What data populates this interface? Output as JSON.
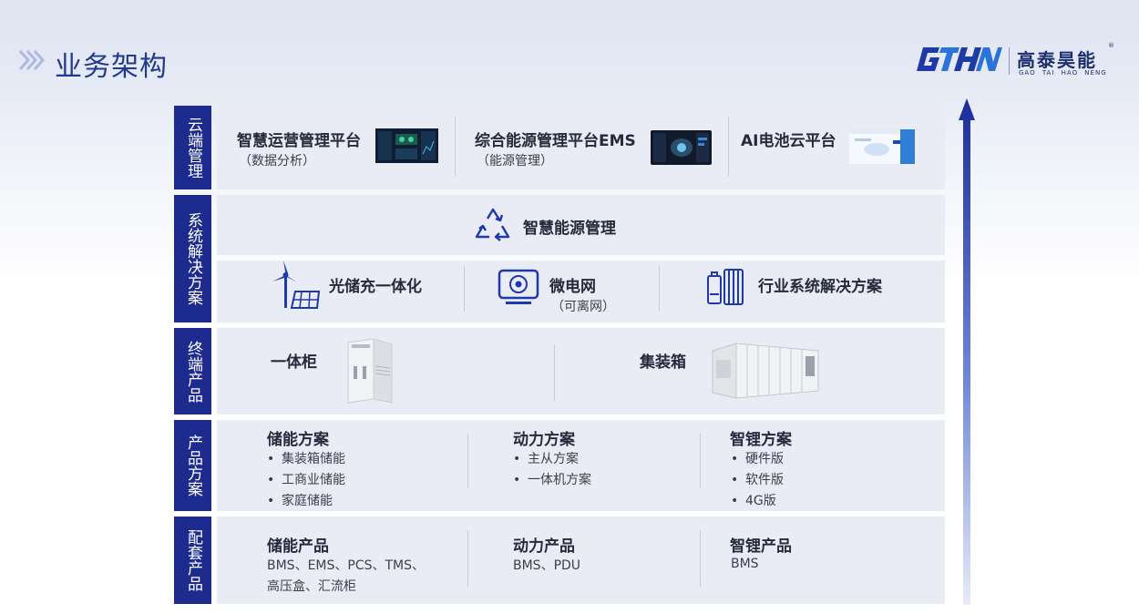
{
  "header": {
    "title": "业务架构",
    "logo": {
      "letters": "GTHN",
      "name_cn": "高泰昊能",
      "name_en": "GAO TAI HAO NENG",
      "reg": "®"
    }
  },
  "rows": {
    "cloud": {
      "label": "云端管理",
      "items": [
        {
          "title": "智慧运营管理平台",
          "sub": "（数据分析）"
        },
        {
          "title": "综合能源管理平台EMS",
          "sub": "（能源管理）"
        },
        {
          "title": "AI电池云平台"
        }
      ]
    },
    "system": {
      "label": "系统解决方案",
      "top": "智慧能源管理",
      "items": [
        {
          "title": "光储充一体化"
        },
        {
          "title": "微电网",
          "sub": "（可离网）"
        },
        {
          "title": "行业系统解决方案"
        }
      ]
    },
    "terminal": {
      "label": "终端产品",
      "items": [
        {
          "title": "一体柜"
        },
        {
          "title": "集装箱"
        }
      ]
    },
    "solutions": {
      "label": "产品方案",
      "columns": [
        {
          "title": "储能方案",
          "bullets": [
            "集装箱储能",
            "工商业储能",
            "家庭储能"
          ]
        },
        {
          "title": "动力方案",
          "bullets": [
            "主从方案",
            "一体机方案"
          ]
        },
        {
          "title": "智锂方案",
          "bullets": [
            "硬件版",
            "软件版",
            "4G版"
          ]
        }
      ]
    },
    "supporting": {
      "label": "配套产品",
      "columns": [
        {
          "title": "储能产品",
          "lines": [
            "BMS、EMS、PCS、TMS、",
            "高压盒、汇流柜"
          ]
        },
        {
          "title": "动力产品",
          "lines": [
            "BMS、PDU"
          ]
        },
        {
          "title": "智锂产品",
          "lines": [
            "BMS"
          ]
        }
      ]
    }
  },
  "colors": {
    "accent": "#1d2b8f",
    "band": "#e9ecf5",
    "title": "#1f3a8f"
  }
}
